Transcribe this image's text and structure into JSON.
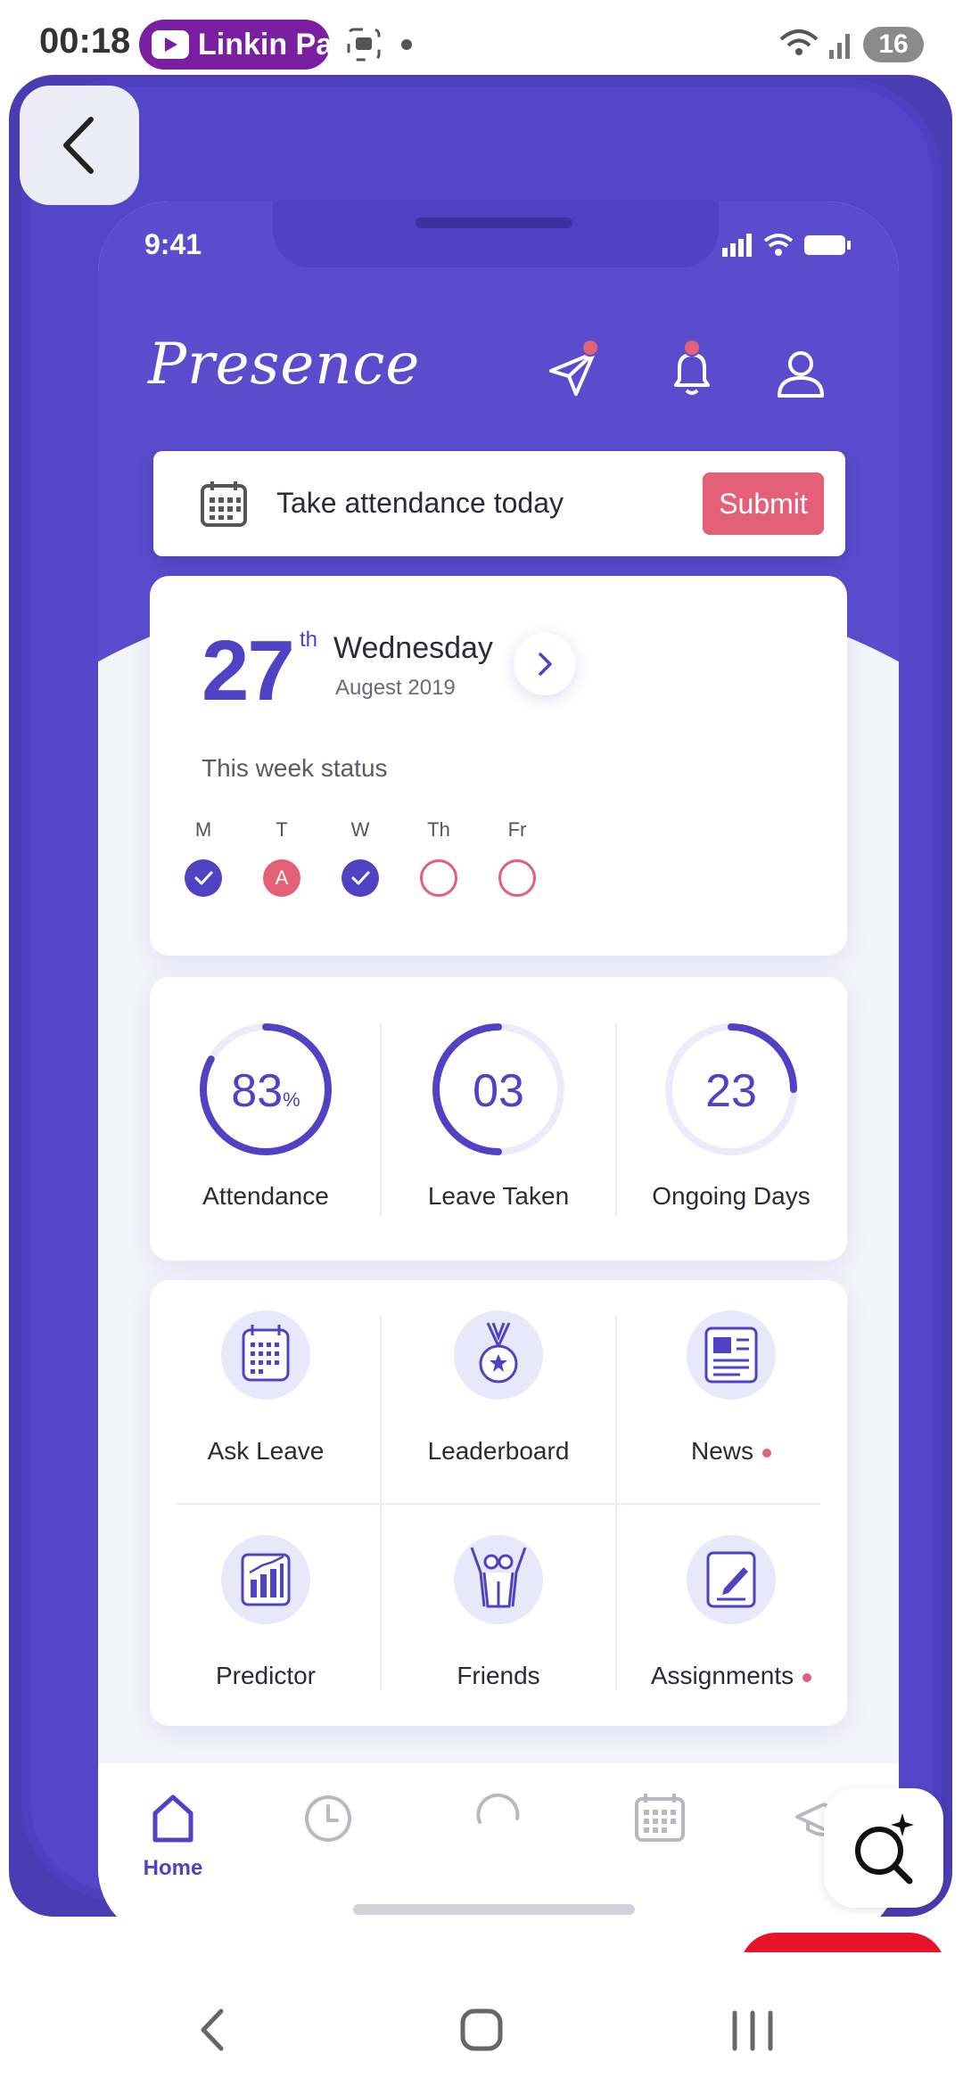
{
  "status_bar": {
    "time": "00:18",
    "media_app": "Linkin Pa",
    "battery": "16"
  },
  "phone": {
    "time": "9:41"
  },
  "app": {
    "logo": "Presence",
    "header_icons": [
      "send-icon",
      "bell-icon",
      "profile-icon"
    ],
    "colors": {
      "primary": "#5a4ccc",
      "accent": "#e46077",
      "background": "#f4f4fb"
    }
  },
  "attendance_bar": {
    "text": "Take attendance today",
    "submit_label": "Submit"
  },
  "date_card": {
    "day": "27",
    "suffix": "th",
    "weekday": "Wednesday",
    "month_year": "Augest 2019",
    "week_title": "This week status",
    "days": [
      {
        "label": "M",
        "state": "present",
        "mark": ""
      },
      {
        "label": "T",
        "state": "absent",
        "mark": "A"
      },
      {
        "label": "W",
        "state": "present",
        "mark": ""
      },
      {
        "label": "Th",
        "state": "pending",
        "mark": ""
      },
      {
        "label": "Fr",
        "state": "pending",
        "mark": ""
      }
    ]
  },
  "stats": [
    {
      "value": "83",
      "unit": "%",
      "label": "Attendance",
      "fraction": 0.83
    },
    {
      "value": "03",
      "unit": "",
      "label": "Leave Taken",
      "fraction": 0.5
    },
    {
      "value": "23",
      "unit": "",
      "label": "Ongoing Days",
      "fraction": 0.25
    }
  ],
  "menu": [
    {
      "label": "Ask Leave",
      "icon": "calendar-grid-icon",
      "dot": false
    },
    {
      "label": "Leaderboard",
      "icon": "medal-icon",
      "dot": false
    },
    {
      "label": "News",
      "icon": "newspaper-icon",
      "dot": true
    },
    {
      "label": "Predictor",
      "icon": "bar-chart-icon",
      "dot": false
    },
    {
      "label": "Friends",
      "icon": "friends-icon",
      "dot": false
    },
    {
      "label": "Assignments",
      "icon": "assignment-icon",
      "dot": true
    }
  ],
  "bottom_nav": {
    "active_label": "Home",
    "items": [
      "home-icon",
      "clock-icon",
      "loading-icon",
      "calendar-icon",
      "graduation-cap-icon"
    ]
  }
}
